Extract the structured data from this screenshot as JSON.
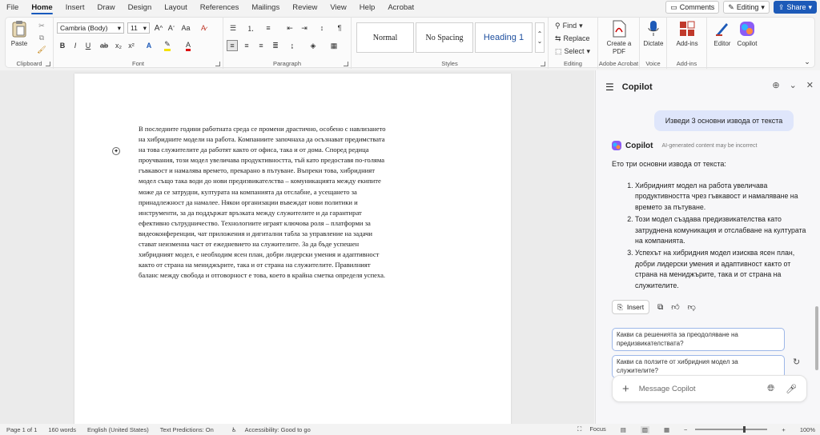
{
  "menu": {
    "tabs": [
      "File",
      "Home",
      "Insert",
      "Draw",
      "Design",
      "Layout",
      "References",
      "Mailings",
      "Review",
      "View",
      "Help",
      "Acrobat"
    ],
    "active": "Home",
    "comments_label": "Comments",
    "editing_label": "Editing",
    "share_label": "Share"
  },
  "ribbon": {
    "clipboard": {
      "paste_label": "Paste",
      "group_label": "Clipboard"
    },
    "font": {
      "font_name": "Cambria (Body)",
      "font_size": "11",
      "group_label": "Font"
    },
    "paragraph": {
      "group_label": "Paragraph"
    },
    "styles": {
      "items": [
        "Normal",
        "No Spacing",
        "Heading 1"
      ],
      "group_label": "Styles"
    },
    "editing": {
      "find_label": "Find",
      "replace_label": "Replace",
      "select_label": "Select",
      "group_label": "Editing"
    },
    "acrobat": {
      "create_pdf_label": "Create a PDF",
      "group_label": "Adobe Acrobat"
    },
    "voice": {
      "dictate_label": "Dictate",
      "group_label": "Voice"
    },
    "addins": {
      "addins_label": "Add-ins",
      "group_label": "Add-ins"
    },
    "editor_label": "Editor",
    "copilot_label": "Copilot"
  },
  "document": {
    "body": "В последните години работната среда се промени драстично, особено с навлизането\nна хибридните модели на работа. Компаниите започнаха да осъзнават предимствата\nна това служителите да работят както от офиса, така и от дома. Според редица\nпроучвания, този модел увеличава продуктивността, тъй като предоставя по-голяма\nгъвкавост и намалява времето, прекарано в пътуване. Въпреки това, хибридният\nмодел също така води до нови предизвикателства – комуникацията между екипите\nможе да се затрудни, културата на компанията да отслабне, а усещането за\nпринадлежност да намалее. Някои организации въвеждат нови политики и\nинструменти, за да поддържат връзката между служителите и да гарантират\nефективно сътрудничество. Технологиите играят ключова роля – платформи за\nвидеоконференции, чат приложения и дигитални табла за управление на задачи\nстават неизменна част от ежедневието на служителите. За да бъде успешен\nхибридният модел, е необходим ясен план, добри лидерски умения и адаптивност\nкакто от страна на мениджърите, така и от страна на служителите. Правилният\nбаланс между свобода и отговорност е това, което в крайна сметка определя успеха."
  },
  "copilot": {
    "title": "Copilot",
    "user_message": "Изведи 3 основни извода от текста",
    "sender": "Copilot",
    "ai_note": "AI-generated content may be incorrect",
    "intro": "Ето три основни извода от текста:",
    "points": [
      "Хибридният модел на работа увеличава продуктивността чрез гъвкавост и намаляване на времето за пътуване.",
      "Този модел създава предизвикателства като затруднена комуникация и отслабване на културата на компанията.",
      "Успехът на хибридния модел изисква ясен план, добри лидерски умения и адаптивност както от страна на мениджърите, така и от страна на служителите."
    ],
    "insert_label": "Insert",
    "suggestions": [
      "Какви са решенията за преодоляване на предизвикателствата?",
      "Какви са ползите от хибридния модел за служителите?"
    ],
    "input_placeholder": "Message Copilot"
  },
  "status": {
    "page": "Page 1 of 1",
    "words": "160 words",
    "language": "English (United States)",
    "predictions": "Text Predictions: On",
    "accessibility": "Accessibility: Good to go",
    "focus": "Focus",
    "zoom": "100%"
  },
  "colors": {
    "accent": "#185abd",
    "share": "#1d5ab8",
    "user_bubble": "#dfe6fb"
  }
}
